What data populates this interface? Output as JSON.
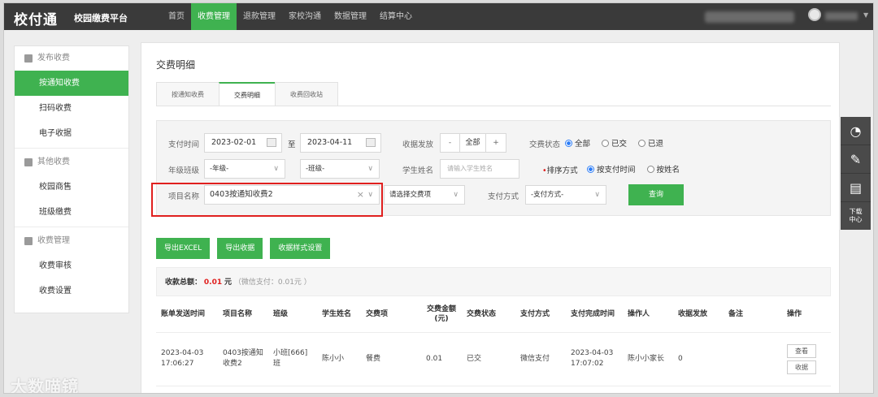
{
  "header": {
    "logo": "校付通",
    "platform": "校园缴费平台",
    "nav": [
      "首页",
      "收费管理",
      "退款管理",
      "家校沟通",
      "数据管理",
      "结算中心"
    ],
    "active_nav": 1
  },
  "sidebar": {
    "groups": [
      {
        "label": "发布收费",
        "items": [
          "按通知收费",
          "扫码收费",
          "电子收据"
        ]
      },
      {
        "label": "其他收费",
        "items": [
          "校园商售",
          "班级缴费"
        ]
      },
      {
        "label": "收费管理",
        "items": [
          "收费审核",
          "收费设置"
        ]
      }
    ]
  },
  "right_rail": {
    "download": "下载中心"
  },
  "main": {
    "title": "交费明细",
    "tabs": [
      "按通知收费",
      "交费明细",
      "收费回收站"
    ],
    "active_tab": 1,
    "filters": {
      "pay_time_label": "支付时间",
      "date_from": "2023-02-01",
      "to_label": "至",
      "date_to": "2023-04-11",
      "receipt_label": "收据发放",
      "receipt_minus": "-",
      "receipt_value": "全部",
      "receipt_plus": "+",
      "status_label": "交费状态",
      "status_options": [
        "全部",
        "已交",
        "已退"
      ],
      "grade_label": "年级班级",
      "grade_select": "-年级-",
      "class_select": "-班级-",
      "student_label": "学生姓名",
      "student_placeholder": "请输入学生姓名",
      "sort_label": "排序方式",
      "sort_options": [
        "按支付时间",
        "按姓名"
      ],
      "project_label": "项目名称",
      "project_value": "0403按通知收费2",
      "project_clear": "×",
      "fee_item_select": "请选择交费项",
      "pay_method_label": "支付方式",
      "pay_method_select": "-支付方式-",
      "query_button": "查询"
    },
    "actions": [
      "导出EXCEL",
      "导出收据",
      "收据样式设置"
    ],
    "summary": {
      "label": "收款总额：",
      "amount": "0.01",
      "unit": "元",
      "detail": "（微信支付：0.01元 ）"
    },
    "table": {
      "headers": [
        "账单发送时间",
        "项目名称",
        "班级",
        "学生姓名",
        "交费项",
        "交费金额(元)",
        "交费状态",
        "支付方式",
        "支付完成时间",
        "操作人",
        "收据发放",
        "备注",
        "操作"
      ],
      "rows": [
        {
          "send_time": "2023-04-03 17:06:27",
          "project": "0403按通知收费2",
          "class": "小班[666]班",
          "student": "陈小小",
          "fee_item": "餐费",
          "amount": "0.01",
          "status": "已交",
          "pay_method": "微信支付",
          "complete_time": "2023-04-03 17:07:02",
          "operator": "陈小小家长",
          "receipt": "0",
          "remark": "",
          "ops": [
            "查看",
            "收据"
          ]
        }
      ]
    }
  },
  "watermark": "大数喵镜"
}
